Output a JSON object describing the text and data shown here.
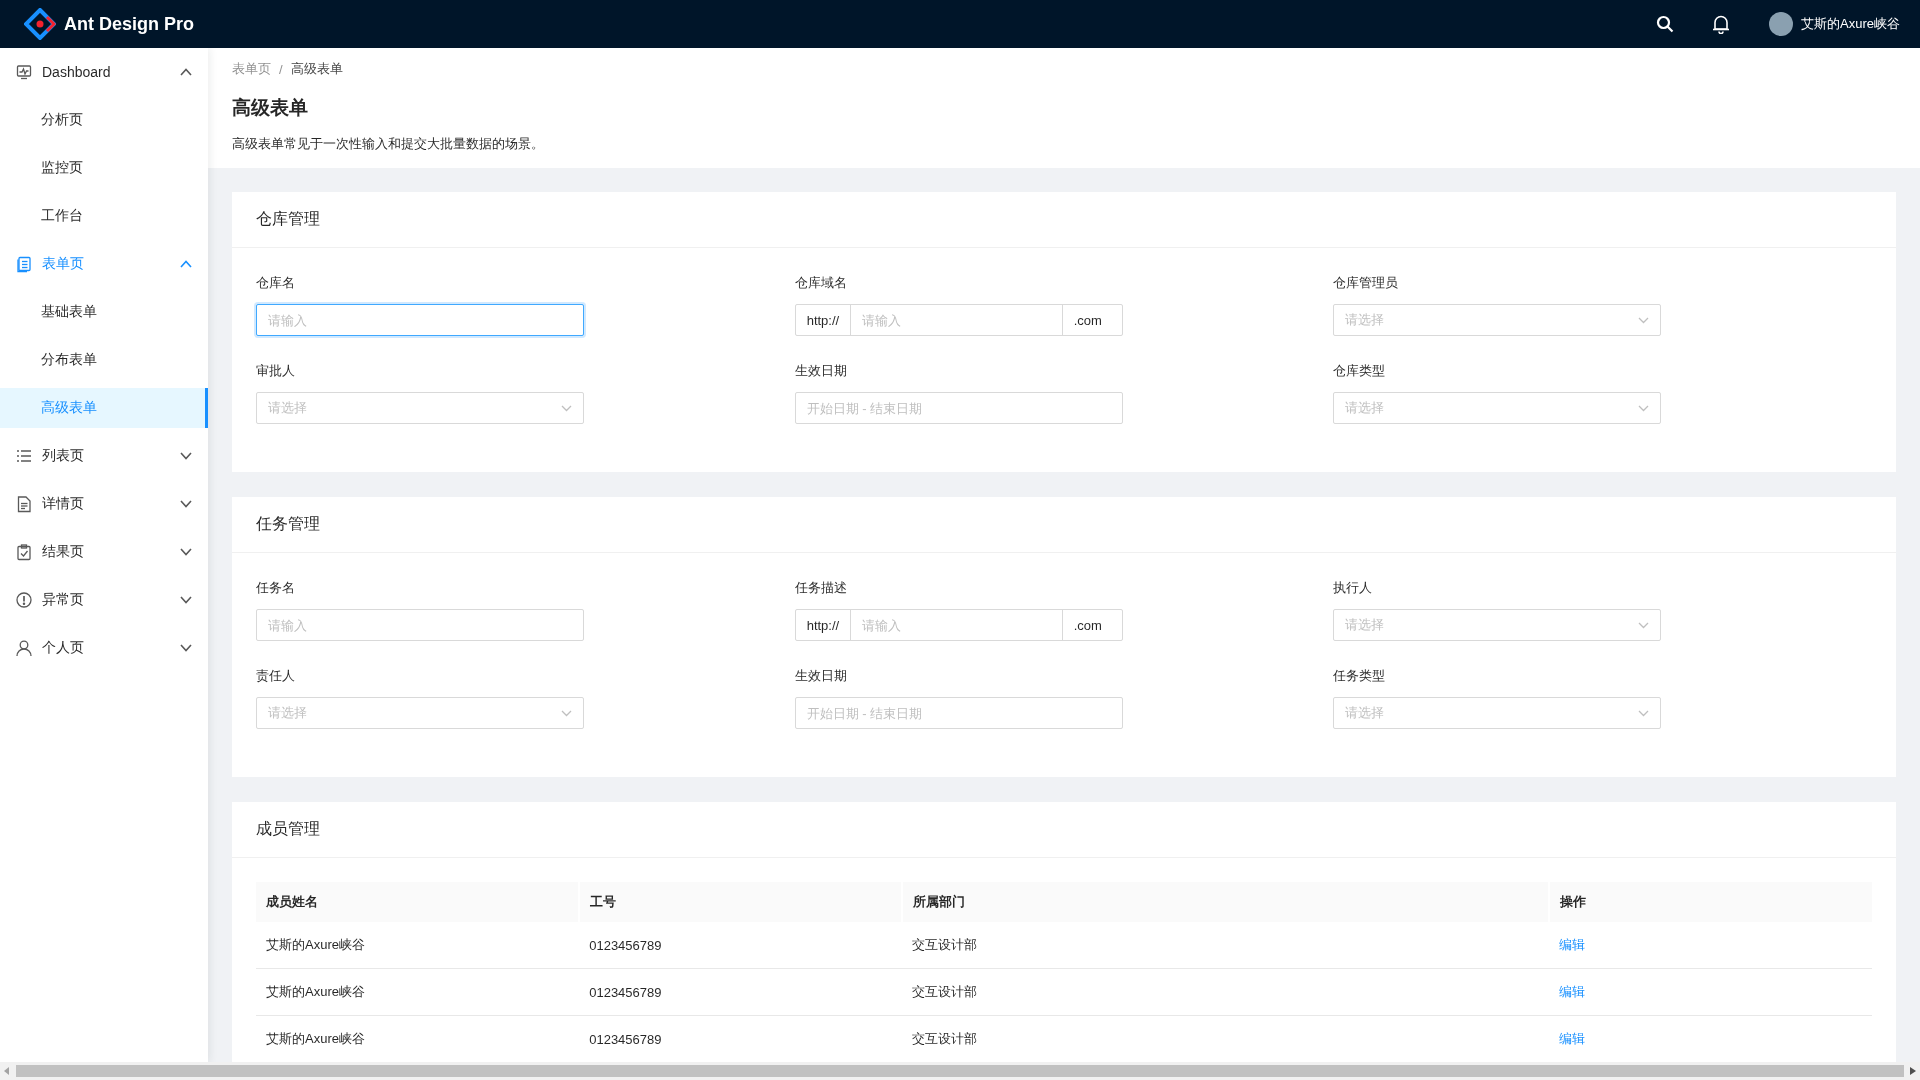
{
  "header": {
    "app_name": "Ant Design Pro",
    "user_name": "艾斯的Axure峡谷"
  },
  "sidebar": {
    "items": [
      {
        "label": "Dashboard",
        "expanded": true,
        "selected": false,
        "children": [
          {
            "label": "分析页",
            "selected": false
          },
          {
            "label": "监控页",
            "selected": false
          },
          {
            "label": "工作台",
            "selected": false
          }
        ]
      },
      {
        "label": "表单页",
        "expanded": true,
        "selected": true,
        "children": [
          {
            "label": "基础表单",
            "selected": false
          },
          {
            "label": "分布表单",
            "selected": false
          },
          {
            "label": "高级表单",
            "selected": true
          }
        ]
      },
      {
        "label": "列表页",
        "expanded": false,
        "selected": false
      },
      {
        "label": "详情页",
        "expanded": false,
        "selected": false
      },
      {
        "label": "结果页",
        "expanded": false,
        "selected": false
      },
      {
        "label": "异常页",
        "expanded": false,
        "selected": false
      },
      {
        "label": "个人页",
        "expanded": false,
        "selected": false
      }
    ]
  },
  "breadcrumb": {
    "items": [
      "表单页",
      "高级表单"
    ],
    "separator": "/"
  },
  "page_header": {
    "title": "高级表单",
    "description": "高级表单常见于一次性输入和提交大批量数据的场景。"
  },
  "sections": [
    {
      "title": "仓库管理",
      "fields": [
        {
          "label": "仓库名",
          "kind": "input",
          "placeholder": "请输入",
          "focused": true
        },
        {
          "label": "仓库域名",
          "kind": "addon",
          "prefix": "http://",
          "placeholder": "请输入",
          "suffix": ".com",
          "focused": false
        },
        {
          "label": "仓库管理员",
          "kind": "select",
          "placeholder": "请选择",
          "focused": false
        },
        {
          "label": "审批人",
          "kind": "select",
          "placeholder": "请选择",
          "focused": false
        },
        {
          "label": "生效日期",
          "kind": "range",
          "placeholder": "开始日期 - 结束日期",
          "focused": false
        },
        {
          "label": "仓库类型",
          "kind": "select",
          "placeholder": "请选择",
          "focused": false
        }
      ]
    },
    {
      "title": "任务管理",
      "fields": [
        {
          "label": "任务名",
          "kind": "input",
          "placeholder": "请输入",
          "focused": false
        },
        {
          "label": "任务描述",
          "kind": "addon",
          "prefix": "http://",
          "placeholder": "请输入",
          "suffix": ".com",
          "focused": false
        },
        {
          "label": "执行人",
          "kind": "select",
          "placeholder": "请选择",
          "focused": false
        },
        {
          "label": "责任人",
          "kind": "select",
          "placeholder": "请选择",
          "focused": false
        },
        {
          "label": "生效日期",
          "kind": "range",
          "placeholder": "开始日期 - 结束日期",
          "focused": false
        },
        {
          "label": "任务类型",
          "kind": "select",
          "placeholder": "请选择",
          "focused": false
        }
      ]
    }
  ],
  "members": {
    "title": "成员管理",
    "columns": [
      "成员姓名",
      "工号",
      "所属部门",
      "操作"
    ],
    "rows": [
      {
        "cells": [
          "艾斯的Axure峡谷",
          "0123456789",
          "交互设计部"
        ],
        "action": "编辑"
      },
      {
        "cells": [
          "艾斯的Axure峡谷",
          "0123456789",
          "交互设计部"
        ],
        "action": "编辑"
      },
      {
        "cells": [
          "艾斯的Axure峡谷",
          "0123456789",
          "交互设计部"
        ],
        "action": "编辑"
      }
    ]
  }
}
